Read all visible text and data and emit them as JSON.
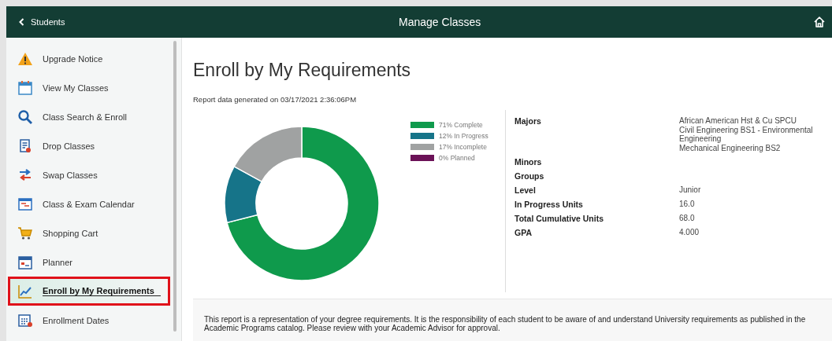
{
  "header": {
    "back_label": "Students",
    "title": "Manage Classes"
  },
  "sidebar": {
    "items": [
      {
        "kind": "warning",
        "label": "Upgrade Notice",
        "selected": false,
        "highlighted": false
      },
      {
        "kind": "calendar",
        "label": "View My Classes",
        "selected": false,
        "highlighted": false
      },
      {
        "kind": "search",
        "label": "Class Search & Enroll",
        "selected": false,
        "highlighted": false
      },
      {
        "kind": "drop",
        "label": "Drop Classes",
        "selected": false,
        "highlighted": false
      },
      {
        "kind": "swap",
        "label": "Swap Classes",
        "selected": false,
        "highlighted": false
      },
      {
        "kind": "schedule",
        "label": "Class & Exam Calendar",
        "selected": false,
        "highlighted": false
      },
      {
        "kind": "cart",
        "label": "Shopping Cart",
        "selected": false,
        "highlighted": false
      },
      {
        "kind": "planner",
        "label": "Planner",
        "selected": false,
        "highlighted": false
      },
      {
        "kind": "chart",
        "label": "Enroll by My Requirements",
        "selected": true,
        "highlighted": true
      },
      {
        "kind": "dates",
        "label": "Enrollment Dates",
        "selected": false,
        "highlighted": false
      }
    ]
  },
  "page": {
    "title": "Enroll by My Requirements",
    "generated": "Report data generated on 03/17/2021 2:36:06PM",
    "chart_data": {
      "type": "donut",
      "categories": [
        "71% Complete",
        "12% In Progress",
        "17% Incomplete",
        "0% Planned"
      ],
      "values": [
        71,
        12,
        17,
        0
      ],
      "colors": [
        "#0f9a4c",
        "#167489",
        "#a0a2a2",
        "#6b1257"
      ]
    },
    "details": [
      {
        "label": "Majors",
        "values": [
          "African American Hst & Cu SPCU",
          "Civil Engineering BS1 - Environmental Engineering",
          "Mechanical Engineering BS2"
        ]
      },
      {
        "label": "Minors"
      },
      {
        "label": "Groups"
      },
      {
        "label": "Level",
        "values": [
          "Junior"
        ]
      },
      {
        "label": "In Progress Units",
        "values": [
          "16.0"
        ]
      },
      {
        "label": "Total Cumulative Units",
        "values": [
          "68.0"
        ]
      },
      {
        "label": "GPA",
        "values": [
          "4.000"
        ]
      }
    ],
    "note": "This report is a representation of your degree requirements. It is the responsibility of each student to be aware of and understand University requirements as published in the Academic Programs catalog. Please review with your Academic Advisor for approval."
  }
}
